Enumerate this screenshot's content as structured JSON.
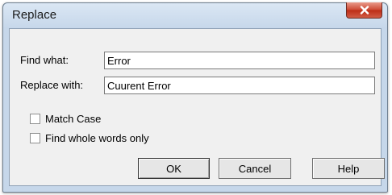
{
  "window": {
    "title": "Replace"
  },
  "fields": {
    "find_label": "Find what:",
    "find_value": "Error",
    "replace_label": "Replace with:",
    "replace_value": "Cuurent Error"
  },
  "options": {
    "match_case_label": "Match Case",
    "match_case_checked": false,
    "whole_words_label": "Find whole words only",
    "whole_words_checked": false
  },
  "buttons": {
    "ok": "OK",
    "cancel": "Cancel",
    "help": "Help"
  },
  "icons": {
    "close": "close-icon"
  },
  "colors": {
    "close_button": "#c8442e",
    "titlebar": "#c6d7ea"
  }
}
